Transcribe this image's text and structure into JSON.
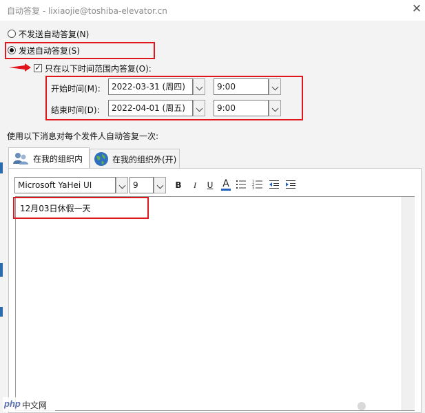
{
  "window": {
    "title": "自动答复 - lixiaojie@toshiba-elevator.cn",
    "close_glyph": "✕"
  },
  "options": {
    "no_auto_reply": "不发送自动答复(N)",
    "send_auto_reply": "发送自动答复(S)",
    "only_time_range": "只在以下时间范围内答复(O):"
  },
  "time": {
    "start_label": "开始时间(M):",
    "start_date": "2022-03-31 (周四)",
    "start_time": "9:00",
    "end_label": "结束时间(D):",
    "end_date": "2022-04-01 (周五)",
    "end_time": "9:00"
  },
  "instruction": "使用以下消息对每个发件人自动答复一次:",
  "tabs": {
    "inside": "在我的组织内",
    "outside": "在我的组织外(开)"
  },
  "format": {
    "font_name": "Microsoft YaHei UI",
    "font_size": "9",
    "bold": "B",
    "italic": "I",
    "underline": "U",
    "font_color": "A"
  },
  "message": {
    "body": "12月03日休假一天"
  },
  "watermark": {
    "brand": "php",
    "site": "中文网"
  },
  "colors": {
    "highlight": "#e0161d",
    "background": "#f3f3f3"
  }
}
